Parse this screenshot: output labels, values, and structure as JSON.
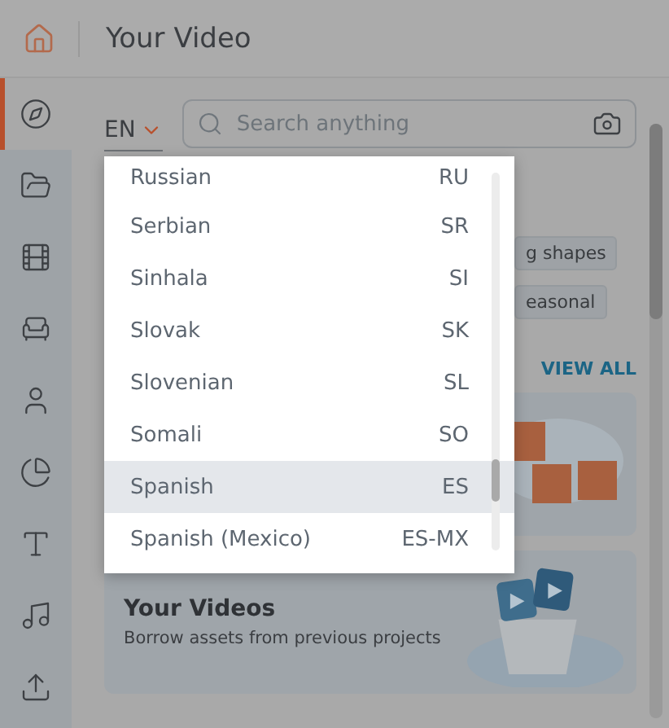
{
  "header": {
    "title": "Your Video"
  },
  "sidebar": {
    "items": [
      {
        "kind": "compass",
        "selected": true
      },
      {
        "kind": "folder",
        "selected": false
      },
      {
        "kind": "film",
        "selected": false
      },
      {
        "kind": "armchair",
        "selected": false
      },
      {
        "kind": "user",
        "selected": false
      },
      {
        "kind": "chart",
        "selected": false
      },
      {
        "kind": "text",
        "selected": false
      },
      {
        "kind": "music",
        "selected": false
      },
      {
        "kind": "upload",
        "selected": false
      }
    ]
  },
  "language": {
    "value": "EN"
  },
  "search": {
    "placeholder": "Search anything"
  },
  "chips": [
    "g shapes",
    "easonal"
  ],
  "view_all": "VIEW ALL",
  "cards": [
    {
      "kind": "elements"
    },
    {
      "kind": "videos",
      "title": "Your Videos",
      "subtitle": "Borrow assets from previous projects"
    }
  ],
  "language_menu": {
    "items": [
      {
        "name": "Russian",
        "code": "RU",
        "selected": false
      },
      {
        "name": "Serbian",
        "code": "SR",
        "selected": false
      },
      {
        "name": "Sinhala",
        "code": "SI",
        "selected": false
      },
      {
        "name": "Slovak",
        "code": "SK",
        "selected": false
      },
      {
        "name": "Slovenian",
        "code": "SL",
        "selected": false
      },
      {
        "name": "Somali",
        "code": "SO",
        "selected": false
      },
      {
        "name": "Spanish",
        "code": "ES",
        "selected": true
      },
      {
        "name": "Spanish (Mexico)",
        "code": "ES-MX",
        "selected": false
      }
    ]
  }
}
